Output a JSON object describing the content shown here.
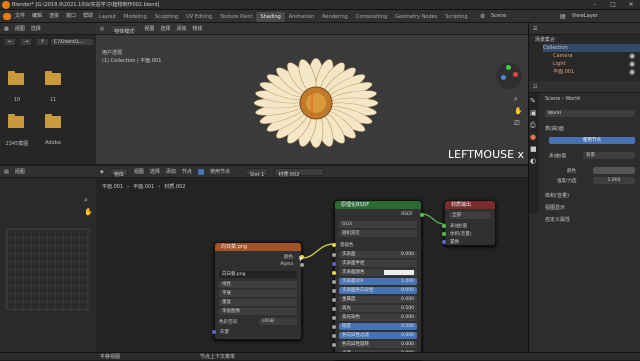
{
  "titlebar": {
    "title": "Blender* [G:\\2018.9\\2021.10\\bl实验学习\\植物制作002.blend]"
  },
  "menu": {
    "items": [
      "文件",
      "编辑",
      "渲染",
      "窗口",
      "帮助"
    ]
  },
  "workspace_tabs": [
    "Layout",
    "Modeling",
    "Sculpting",
    "UV Editing",
    "Texture Paint",
    "Shading",
    "Animation",
    "Rendering",
    "Compositing",
    "Geometry Nodes",
    "Scripting"
  ],
  "active_tab": "Shading",
  "scene": {
    "label": "Scene",
    "view_layer": "ViewLayer"
  },
  "filebrowser": {
    "header": [
      "视图",
      "选择"
    ],
    "path": "C:\\Users\\L...",
    "folders": [
      {
        "name": "10"
      },
      {
        "name": "11"
      },
      {
        "name": "2345截图"
      },
      {
        "name": "Adobe"
      }
    ]
  },
  "viewport": {
    "mode": "物体模式",
    "menus": [
      "视图",
      "选择",
      "添加",
      "物体"
    ],
    "info_line1": "用户透视",
    "info_line2": "(1) Collection | 平面.001",
    "overlay_text": "LEFTMOUSE x 2"
  },
  "node_editor": {
    "header_menus": [
      "物体",
      "视图",
      "选择",
      "添加",
      "节点"
    ],
    "use_nodes": "使用节点",
    "slot": "Slot 1",
    "material": "材质.002",
    "breadcrumb": [
      "平面.001",
      "平面.001",
      "材质.002"
    ],
    "image_node": {
      "title": "向日葵.png",
      "out_color": "颜色",
      "out_alpha": "Alpha",
      "image_name": "向日葵.png",
      "rows": [
        "线性",
        "平展",
        "重复",
        "单张图像"
      ],
      "colorspace_label": "色彩空间",
      "colorspace": "sRGB",
      "in_vector": "矢量"
    },
    "bsdf_node": {
      "title": "原理化BSDF",
      "out": "BSDF",
      "distribution": "GGX",
      "subsurface_method": "随机游走",
      "in_basecolor": "基础色",
      "inputs": [
        {
          "label": "次表面",
          "value": "0.000"
        },
        {
          "label": "次表面半径",
          "value": ""
        },
        {
          "label": "次表面颜色",
          "value": ""
        },
        {
          "label": "次表面IOR",
          "value": "1.400"
        },
        {
          "label": "次表面各向异性",
          "value": "0.000"
        },
        {
          "label": "金属度",
          "value": "0.000"
        },
        {
          "label": "高光",
          "value": "0.500"
        },
        {
          "label": "高光染色",
          "value": "0.000"
        },
        {
          "label": "糙度",
          "value": "0.500"
        },
        {
          "label": "各向异性过滤",
          "value": "0.000"
        },
        {
          "label": "各向异性旋转",
          "value": "0.000"
        },
        {
          "label": "光泽",
          "value": "0.000"
        }
      ]
    },
    "output_node": {
      "title": "材质输出",
      "target": "全部",
      "inputs": [
        "表(曲)面",
        "体积(音量)",
        "置换"
      ]
    }
  },
  "imgpanel": {
    "menus": [
      "视图"
    ]
  },
  "outliner": {
    "title": "场景集合",
    "items": [
      {
        "name": "Collection"
      },
      {
        "name": "Camera"
      },
      {
        "name": "Light"
      },
      {
        "name": "平面.001"
      }
    ]
  },
  "props": {
    "scene": "Scene",
    "world": "World",
    "world_name": "World",
    "surface": "表(曲)面",
    "use_nodes": "使用节点",
    "surface_label": "表(曲)面",
    "surface_value": "背景",
    "color_label": "颜色",
    "strength_label": "强度/力度",
    "strength": "1.000",
    "sections": [
      "体积(音量)",
      "视图显示",
      "自定义属性"
    ]
  },
  "statusbar": {
    "left": "平移视图",
    "right": "节点上下文菜单"
  },
  "colors": {
    "accent": "#4772b3",
    "bsdf_header": "#2a6b33",
    "image_header": "#a25428",
    "output_header": "#7a2c2c",
    "folder": "#c99a3c"
  }
}
